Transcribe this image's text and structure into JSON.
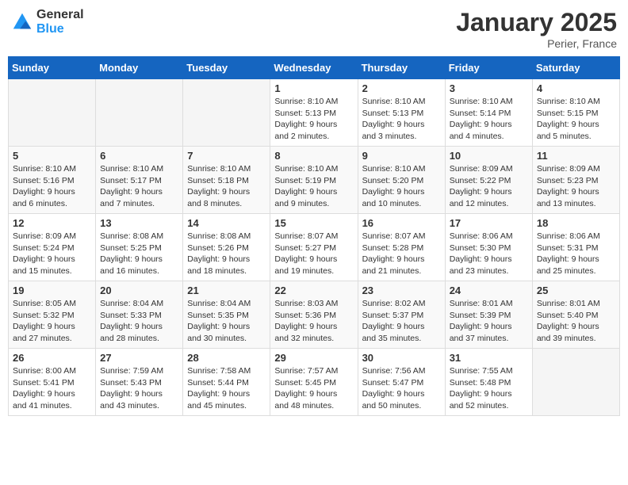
{
  "header": {
    "logo_general": "General",
    "logo_blue": "Blue",
    "month_year": "January 2025",
    "location": "Perier, France"
  },
  "weekdays": [
    "Sunday",
    "Monday",
    "Tuesday",
    "Wednesday",
    "Thursday",
    "Friday",
    "Saturday"
  ],
  "weeks": [
    [
      {
        "day": "",
        "info": ""
      },
      {
        "day": "",
        "info": ""
      },
      {
        "day": "",
        "info": ""
      },
      {
        "day": "1",
        "info": "Sunrise: 8:10 AM\nSunset: 5:13 PM\nDaylight: 9 hours\nand 2 minutes."
      },
      {
        "day": "2",
        "info": "Sunrise: 8:10 AM\nSunset: 5:13 PM\nDaylight: 9 hours\nand 3 minutes."
      },
      {
        "day": "3",
        "info": "Sunrise: 8:10 AM\nSunset: 5:14 PM\nDaylight: 9 hours\nand 4 minutes."
      },
      {
        "day": "4",
        "info": "Sunrise: 8:10 AM\nSunset: 5:15 PM\nDaylight: 9 hours\nand 5 minutes."
      }
    ],
    [
      {
        "day": "5",
        "info": "Sunrise: 8:10 AM\nSunset: 5:16 PM\nDaylight: 9 hours\nand 6 minutes."
      },
      {
        "day": "6",
        "info": "Sunrise: 8:10 AM\nSunset: 5:17 PM\nDaylight: 9 hours\nand 7 minutes."
      },
      {
        "day": "7",
        "info": "Sunrise: 8:10 AM\nSunset: 5:18 PM\nDaylight: 9 hours\nand 8 minutes."
      },
      {
        "day": "8",
        "info": "Sunrise: 8:10 AM\nSunset: 5:19 PM\nDaylight: 9 hours\nand 9 minutes."
      },
      {
        "day": "9",
        "info": "Sunrise: 8:10 AM\nSunset: 5:20 PM\nDaylight: 9 hours\nand 10 minutes."
      },
      {
        "day": "10",
        "info": "Sunrise: 8:09 AM\nSunset: 5:22 PM\nDaylight: 9 hours\nand 12 minutes."
      },
      {
        "day": "11",
        "info": "Sunrise: 8:09 AM\nSunset: 5:23 PM\nDaylight: 9 hours\nand 13 minutes."
      }
    ],
    [
      {
        "day": "12",
        "info": "Sunrise: 8:09 AM\nSunset: 5:24 PM\nDaylight: 9 hours\nand 15 minutes."
      },
      {
        "day": "13",
        "info": "Sunrise: 8:08 AM\nSunset: 5:25 PM\nDaylight: 9 hours\nand 16 minutes."
      },
      {
        "day": "14",
        "info": "Sunrise: 8:08 AM\nSunset: 5:26 PM\nDaylight: 9 hours\nand 18 minutes."
      },
      {
        "day": "15",
        "info": "Sunrise: 8:07 AM\nSunset: 5:27 PM\nDaylight: 9 hours\nand 19 minutes."
      },
      {
        "day": "16",
        "info": "Sunrise: 8:07 AM\nSunset: 5:28 PM\nDaylight: 9 hours\nand 21 minutes."
      },
      {
        "day": "17",
        "info": "Sunrise: 8:06 AM\nSunset: 5:30 PM\nDaylight: 9 hours\nand 23 minutes."
      },
      {
        "day": "18",
        "info": "Sunrise: 8:06 AM\nSunset: 5:31 PM\nDaylight: 9 hours\nand 25 minutes."
      }
    ],
    [
      {
        "day": "19",
        "info": "Sunrise: 8:05 AM\nSunset: 5:32 PM\nDaylight: 9 hours\nand 27 minutes."
      },
      {
        "day": "20",
        "info": "Sunrise: 8:04 AM\nSunset: 5:33 PM\nDaylight: 9 hours\nand 28 minutes."
      },
      {
        "day": "21",
        "info": "Sunrise: 8:04 AM\nSunset: 5:35 PM\nDaylight: 9 hours\nand 30 minutes."
      },
      {
        "day": "22",
        "info": "Sunrise: 8:03 AM\nSunset: 5:36 PM\nDaylight: 9 hours\nand 32 minutes."
      },
      {
        "day": "23",
        "info": "Sunrise: 8:02 AM\nSunset: 5:37 PM\nDaylight: 9 hours\nand 35 minutes."
      },
      {
        "day": "24",
        "info": "Sunrise: 8:01 AM\nSunset: 5:39 PM\nDaylight: 9 hours\nand 37 minutes."
      },
      {
        "day": "25",
        "info": "Sunrise: 8:01 AM\nSunset: 5:40 PM\nDaylight: 9 hours\nand 39 minutes."
      }
    ],
    [
      {
        "day": "26",
        "info": "Sunrise: 8:00 AM\nSunset: 5:41 PM\nDaylight: 9 hours\nand 41 minutes."
      },
      {
        "day": "27",
        "info": "Sunrise: 7:59 AM\nSunset: 5:43 PM\nDaylight: 9 hours\nand 43 minutes."
      },
      {
        "day": "28",
        "info": "Sunrise: 7:58 AM\nSunset: 5:44 PM\nDaylight: 9 hours\nand 45 minutes."
      },
      {
        "day": "29",
        "info": "Sunrise: 7:57 AM\nSunset: 5:45 PM\nDaylight: 9 hours\nand 48 minutes."
      },
      {
        "day": "30",
        "info": "Sunrise: 7:56 AM\nSunset: 5:47 PM\nDaylight: 9 hours\nand 50 minutes."
      },
      {
        "day": "31",
        "info": "Sunrise: 7:55 AM\nSunset: 5:48 PM\nDaylight: 9 hours\nand 52 minutes."
      },
      {
        "day": "",
        "info": ""
      }
    ]
  ]
}
